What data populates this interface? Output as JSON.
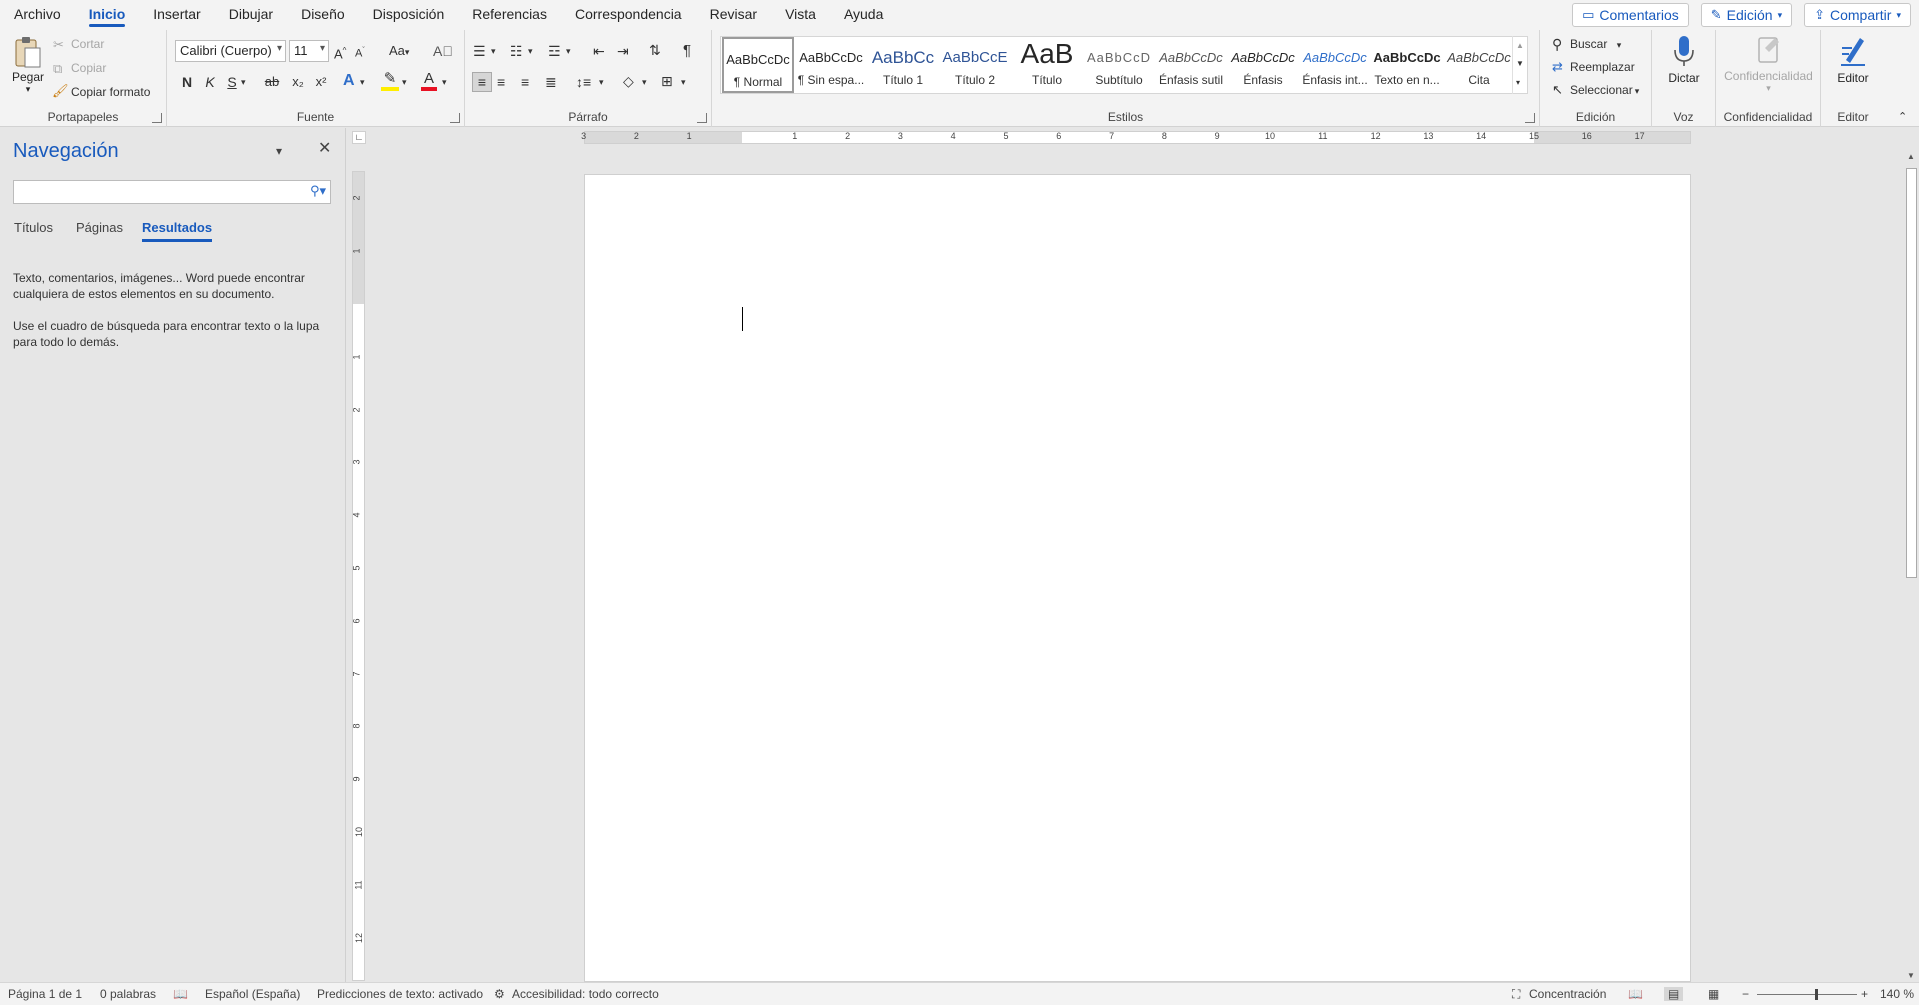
{
  "menu": {
    "tabs": [
      "Archivo",
      "Inicio",
      "Insertar",
      "Dibujar",
      "Diseño",
      "Disposición",
      "Referencias",
      "Correspondencia",
      "Revisar",
      "Vista",
      "Ayuda"
    ],
    "comments_label": "Comentarios",
    "editing_label": "Edición",
    "share_label": "Compartir"
  },
  "ribbon": {
    "clipboard": {
      "label": "Portapapeles",
      "paste": "Pegar",
      "cut": "Cortar",
      "copy": "Copiar",
      "format_painter": "Copiar formato"
    },
    "font": {
      "label": "Fuente",
      "family": "Calibri (Cuerpo)",
      "size": "11",
      "bold": "N",
      "italic": "K",
      "underline": "S",
      "strike": "ab",
      "sub": "x₂",
      "sup": "x²",
      "case": "Aa"
    },
    "paragraph": {
      "label": "Párrafo"
    },
    "styles": {
      "label": "Estilos",
      "items": [
        {
          "preview": "AaBbCcDc",
          "name": "¶ Normal"
        },
        {
          "preview": "AaBbCcDc",
          "name": "¶ Sin espa..."
        },
        {
          "preview": "AaBbCc",
          "name": "Título 1"
        },
        {
          "preview": "AaBbCcE",
          "name": "Título 2"
        },
        {
          "preview": "AaB",
          "name": "Título"
        },
        {
          "preview": "AaBbCcD",
          "name": "Subtítulo"
        },
        {
          "preview": "AaBbCcDc",
          "name": "Énfasis sutil"
        },
        {
          "preview": "AaBbCcDc",
          "name": "Énfasis"
        },
        {
          "preview": "AaBbCcDc",
          "name": "Énfasis int..."
        },
        {
          "preview": "AaBbCcDc",
          "name": "Texto en n..."
        },
        {
          "preview": "AaBbCcDc",
          "name": "Cita"
        }
      ]
    },
    "editing": {
      "label": "Edición",
      "find": "Buscar",
      "replace": "Reemplazar",
      "select": "Seleccionar"
    },
    "voice": {
      "label": "Voz",
      "dictate": "Dictar"
    },
    "sensitivity": {
      "label": "Confidencialidad",
      "button": "Confidencialidad"
    },
    "editor": {
      "label": "Editor",
      "button": "Editor"
    }
  },
  "nav": {
    "title": "Navegación",
    "search_placeholder": "",
    "tabs": [
      "Títulos",
      "Páginas",
      "Resultados"
    ],
    "active_tab": "Resultados",
    "msg1": "Texto, comentarios, imágenes... Word puede encontrar cualquiera de estos elementos en su documento.",
    "msg2": "Use el cuadro de búsqueda para encontrar texto o la lupa para todo lo demás."
  },
  "ruler": {
    "h_ticks": [
      "3",
      "2",
      "1",
      "1",
      "2",
      "3",
      "4",
      "5",
      "6",
      "7",
      "8",
      "9",
      "10",
      "11",
      "12",
      "13",
      "14",
      "15",
      "16",
      "17"
    ],
    "v_ticks": [
      "2",
      "1",
      "1",
      "2",
      "3",
      "4",
      "5",
      "6",
      "7",
      "8",
      "9",
      "10",
      "11",
      "12"
    ]
  },
  "status": {
    "page": "Página 1 de 1",
    "words": "0 palabras",
    "language": "Español (España)",
    "predictions": "Predicciones de texto: activado",
    "accessibility": "Accesibilidad: todo correcto",
    "focus": "Concentración",
    "zoom": "140 %",
    "zoom_level": 0.58
  }
}
